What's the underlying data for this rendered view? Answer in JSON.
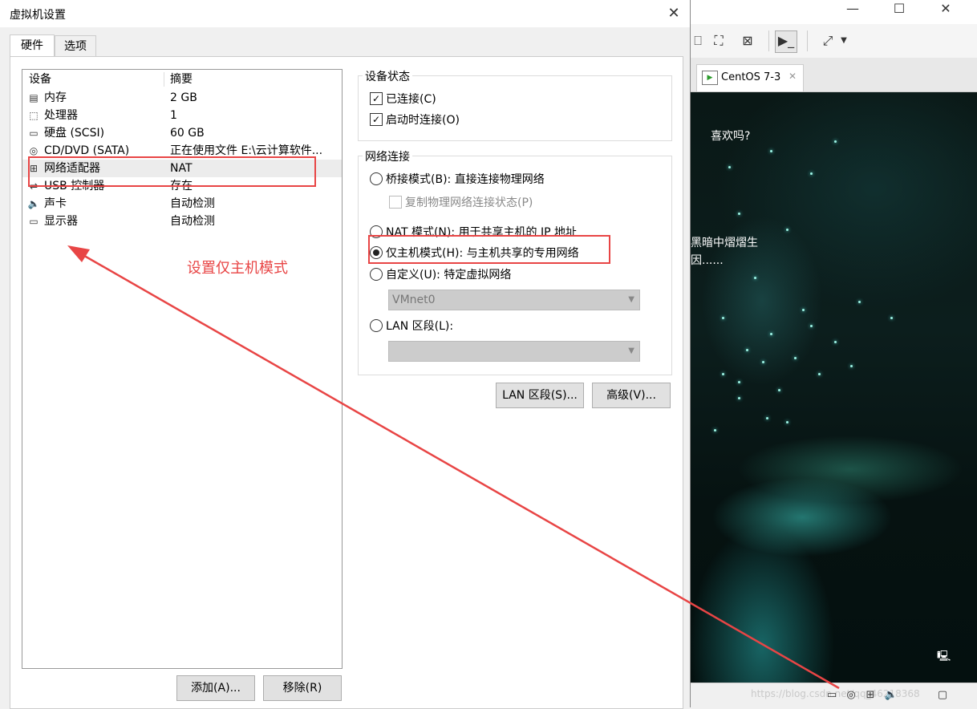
{
  "dialog": {
    "title": "虚拟机设置",
    "close_glyph": "✕",
    "tabs": [
      {
        "label": "硬件"
      },
      {
        "label": "选项"
      }
    ]
  },
  "device_list": {
    "col_device": "设备",
    "col_summary": "摘要",
    "rows": [
      {
        "name": "内存",
        "summary": "2 GB",
        "icon": "memory-icon"
      },
      {
        "name": "处理器",
        "summary": "1",
        "icon": "cpu-icon"
      },
      {
        "name": "硬盘 (SCSI)",
        "summary": "60 GB",
        "icon": "harddisk-icon"
      },
      {
        "name": "CD/DVD (SATA)",
        "summary": "正在使用文件 E:\\云计算软件...",
        "icon": "cdrom-icon"
      },
      {
        "name": "网络适配器",
        "summary": "NAT",
        "icon": "network-adapter-icon"
      },
      {
        "name": "USB 控制器",
        "summary": "存在",
        "icon": "usb-icon"
      },
      {
        "name": "声卡",
        "summary": "自动检测",
        "icon": "speaker-icon"
      },
      {
        "name": "显示器",
        "summary": "自动检测",
        "icon": "monitor-icon"
      }
    ],
    "add_button": "添加(A)...",
    "remove_button": "移除(R)"
  },
  "device_status": {
    "title": "设备状态",
    "connected": {
      "label": "已连接(C)",
      "checked": true
    },
    "connect_at_poweron": {
      "label": "启动时连接(O)",
      "checked": true
    }
  },
  "network": {
    "title": "网络连接",
    "bridged": "桥接模式(B): 直接连接物理网络",
    "replicate": "复制物理网络连接状态(P)",
    "nat": "NAT 模式(N): 用于共享主机的 IP 地址",
    "hostonly": "仅主机模式(H): 与主机共享的专用网络",
    "custom": "自定义(U): 特定虚拟网络",
    "custom_value": "VMnet0",
    "lan": "LAN 区段(L):",
    "lan_value": "",
    "selected": "hostonly"
  },
  "buttons": {
    "lan_segments": "LAN 区段(S)...",
    "advanced": "高级(V)..."
  },
  "annotation": {
    "text": "设置仅主机模式",
    "color": "#e84545"
  },
  "bg_window": {
    "minimize": "—",
    "maximize": "☐",
    "close": "✕",
    "tab_label": "CentOS 7-3",
    "tab_close": "✕",
    "vm_text_1": "喜欢吗?",
    "vm_text_2": "黑暗中熠熠生",
    "vm_text_3": "因......",
    "watermark": "https://blog.csdn.net/qq_46218368"
  }
}
